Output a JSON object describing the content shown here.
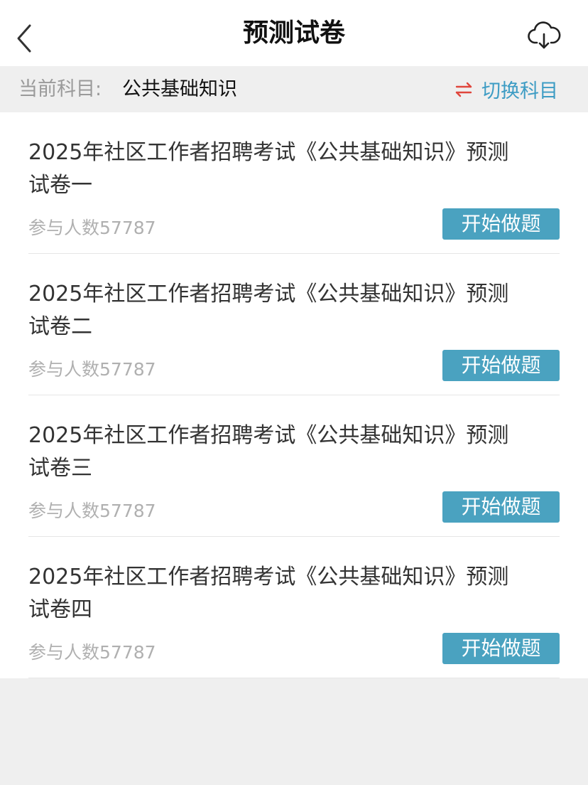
{
  "header": {
    "title": "预测试卷",
    "back_icon": "chevron-left-icon",
    "download_icon": "cloud-download-icon"
  },
  "subject_bar": {
    "label": "当前科目:",
    "value": "公共基础知识",
    "switch_icon": "swap-arrows-icon",
    "switch_label": "切换科目"
  },
  "items": [
    {
      "title": "2025年社区工作者招聘考试《公共基础知识》预测试卷一",
      "count_prefix": "参与人数",
      "count": "57787",
      "button_label": "开始做题"
    },
    {
      "title": "2025年社区工作者招聘考试《公共基础知识》预测试卷二",
      "count_prefix": "参与人数",
      "count": "57787",
      "button_label": "开始做题"
    },
    {
      "title": "2025年社区工作者招聘考试《公共基础知识》预测试卷三",
      "count_prefix": "参与人数",
      "count": "57787",
      "button_label": "开始做题"
    },
    {
      "title": "2025年社区工作者招聘考试《公共基础知识》预测试卷四",
      "count_prefix": "参与人数",
      "count": "57787",
      "button_label": "开始做题"
    }
  ],
  "colors": {
    "accent": "#4aa2c0",
    "switch_text": "#3d9cc4",
    "switch_icon": "#e0463c",
    "background": "#efefef"
  }
}
